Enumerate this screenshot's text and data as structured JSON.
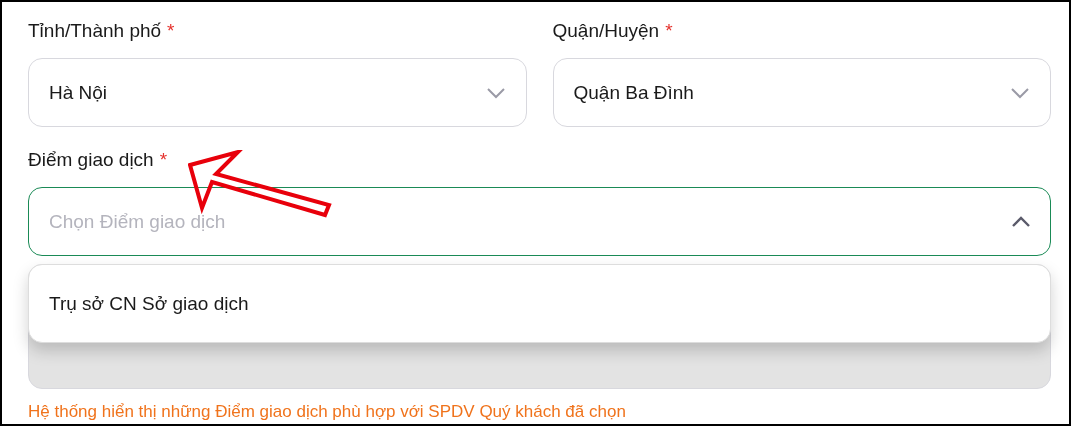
{
  "location_row": [
    {
      "label": "Tỉnh/Thành phố",
      "required": "*",
      "value": "Hà Nội",
      "expanded": false
    },
    {
      "label": "Quận/Huyện",
      "required": "*",
      "value": "Quận Ba Đình",
      "expanded": false
    }
  ],
  "transaction_point": {
    "label": "Điểm giao dịch",
    "required": "*",
    "placeholder": "Chọn Điểm giao dịch",
    "expanded": true,
    "focused": true,
    "options": [
      {
        "label": "Trụ sở CN Sở giao dịch",
        "selected": false
      }
    ]
  },
  "hidden_field": {
    "disabled": true
  },
  "hint": "Hệ thống hiển thị những Điểm giao dịch phù hợp với SPDV Quý khách đã chọn"
}
